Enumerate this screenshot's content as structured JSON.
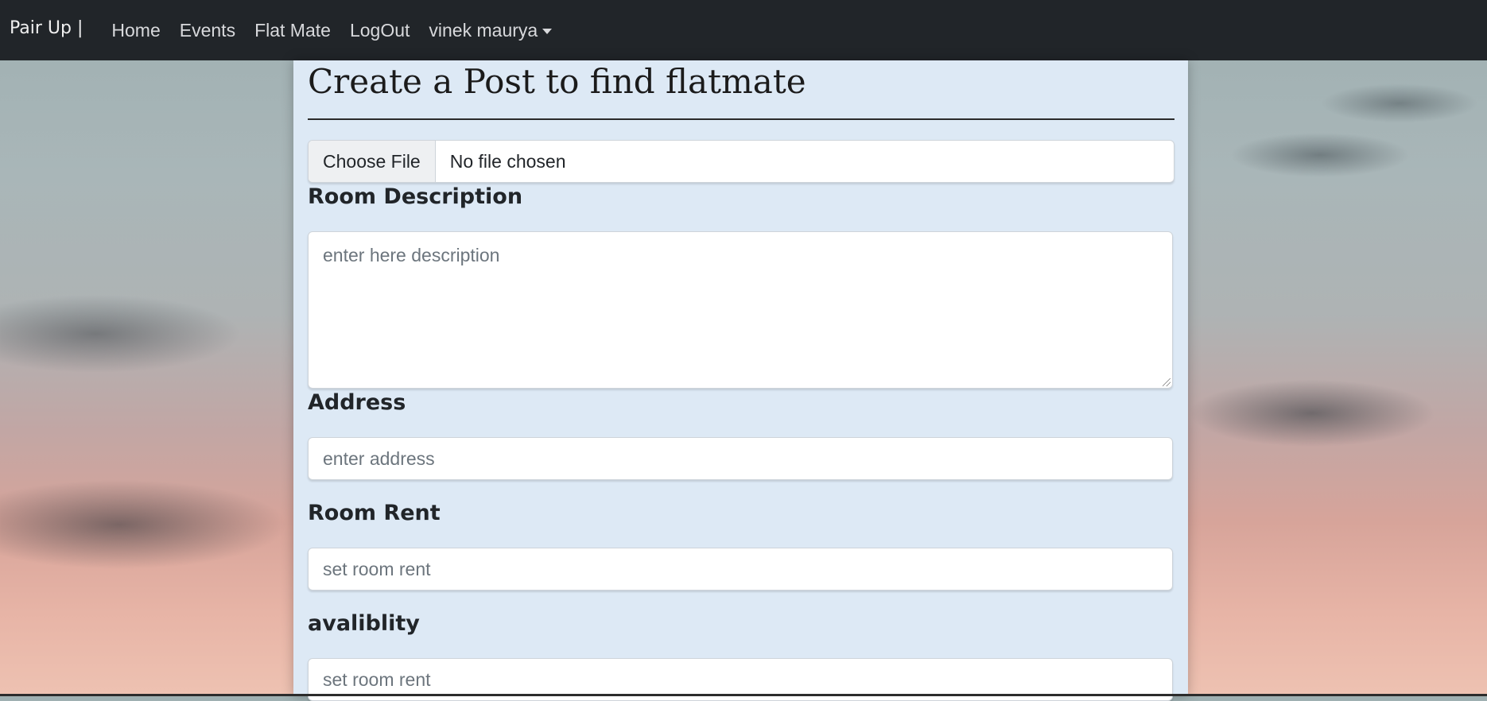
{
  "navbar": {
    "brand": "Pair Up |",
    "links": [
      "Home",
      "Events",
      "Flat Mate",
      "LogOut"
    ],
    "user_dropdown": "vinek maurya"
  },
  "form": {
    "title": "Create a Post to find flatmate",
    "file_button": "Choose File",
    "file_status": "No file chosen",
    "description_label": "Room Description",
    "description_placeholder": "enter here description",
    "address_label": "Address",
    "address_placeholder": "enter address",
    "rent_label": "Room Rent",
    "rent_placeholder": "set room rent",
    "availability_label": "avaliblity",
    "availability_placeholder": "set room rent"
  }
}
